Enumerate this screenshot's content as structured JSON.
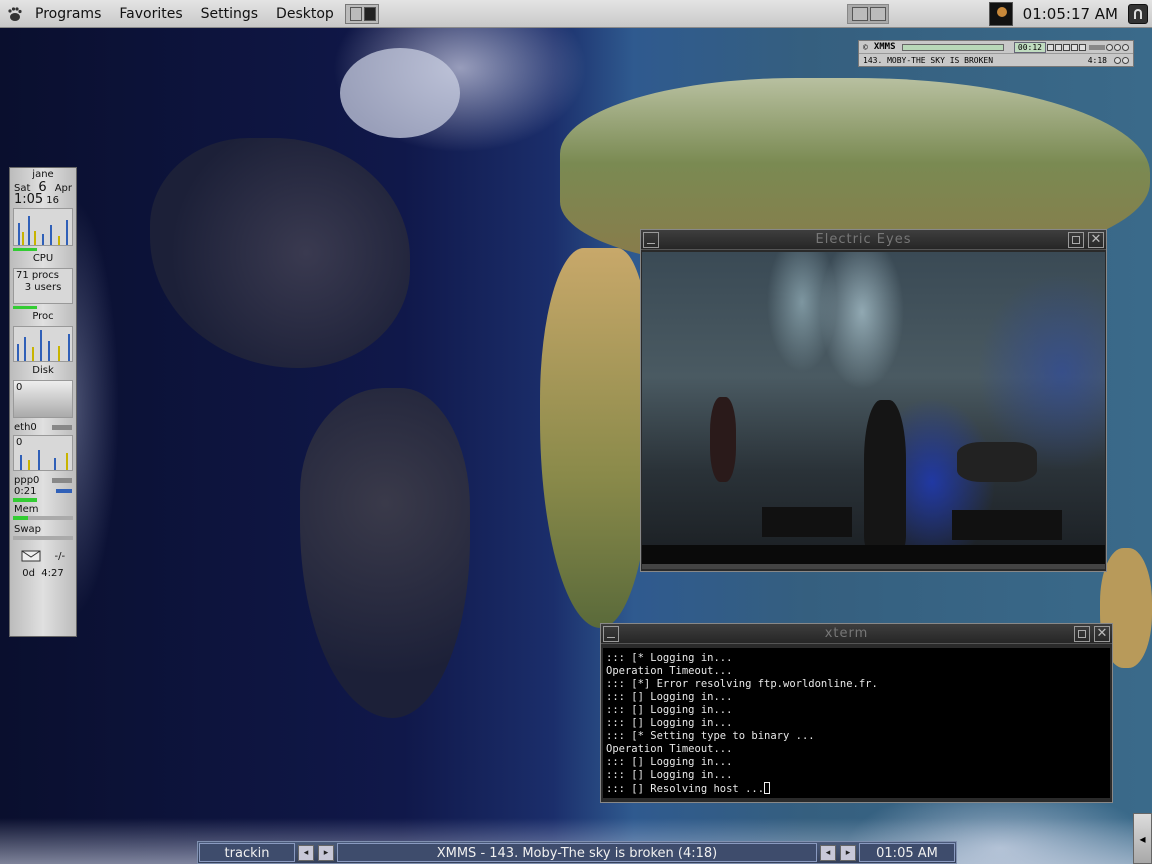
{
  "top_panel": {
    "menus": [
      "Programs",
      "Favorites",
      "Settings",
      "Desktop"
    ],
    "clock": "01:05:17 AM"
  },
  "xmms": {
    "title": "XMMS",
    "time": "00:12",
    "track": "143. MOBY-THE SKY IS BROKEN",
    "length": "4:18"
  },
  "gkrellm": {
    "host": "jane",
    "day": "Sat",
    "date": "6",
    "month": "Apr",
    "time": "1:05",
    "seconds": "16",
    "cpu_label": "CPU",
    "procs": "71 procs",
    "users": "3 users",
    "proc_label": "Proc",
    "disk_label": "Disk",
    "disk_value": "0",
    "eth0_label": "eth0",
    "eth0_value": "0",
    "ppp0_label": "ppp0",
    "ppp0_time": "0:21",
    "mem_label": "Mem",
    "swap_label": "Swap",
    "mail_count": "-/-",
    "uptime": "0d  4:27"
  },
  "electric_eyes": {
    "title": "Electric Eyes"
  },
  "xterm": {
    "title": "xterm",
    "lines": [
      "::: [* Logging in...",
      "Operation Timeout...",
      "::: [*] Error resolving ftp.worldonline.fr.",
      "::: [] Logging in...",
      "::: [] Logging in...",
      "::: [] Logging in...",
      "::: [* Setting type to binary ...",
      "Operation Timeout...",
      "::: [] Logging in...",
      "::: [] Logging in...",
      "::: [] Resolving host ..."
    ]
  },
  "taskbar": {
    "left_label": "trackin",
    "center_label": "XMMS - 143. Moby-The sky is broken (4:18)",
    "clock": "01:05 AM"
  },
  "icons": {
    "gnome": "gnome-foot-icon",
    "mail": "mail-icon",
    "arrow_left": "◂",
    "arrow_right": "▸"
  }
}
